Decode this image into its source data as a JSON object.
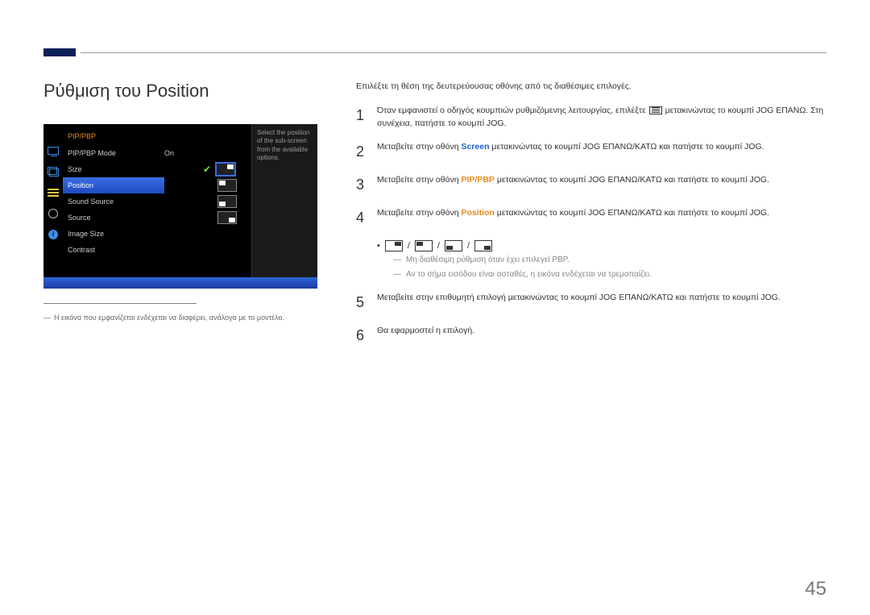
{
  "page_number": "45",
  "heading": "Ρύθμιση του Position",
  "osd": {
    "title": "PIP/PBP",
    "items": [
      {
        "label": "PIP/PBP Mode",
        "value": "On"
      },
      {
        "label": "Size",
        "value": ""
      },
      {
        "label": "Position",
        "value": ""
      },
      {
        "label": "Sound Source",
        "value": ""
      },
      {
        "label": "Source",
        "value": ""
      },
      {
        "label": "Image Size",
        "value": ""
      },
      {
        "label": "Contrast",
        "value": ""
      }
    ],
    "help": "Select the position of the sub-screen from the available options."
  },
  "left_footnote": "Η εικόνα που εμφανίζεται ενδέχεται να διαφέρει, ανάλογα με το μοντέλο.",
  "intro": "Επιλέξτε τη θέση της δευτερεύουσας οθόνης από τις διαθέσιμες επιλογές.",
  "steps": {
    "s1a": "Όταν εμφανιστεί ο οδηγός κουμπιών ρυθμιζόμενης λειτουργίας, επιλέξτε ",
    "s1b": " μετακινώντας το κουμπί JOG ΕΠΑΝΩ. Στη συνέχεια, πατήστε το κουμπί JOG.",
    "s2a": "Μεταβείτε στην οθόνη ",
    "s2_screen": "Screen",
    "s2b": " μετακινώντας το κουμπί JOG ΕΠΑΝΩ/ΚΑΤΩ και πατήστε το κουμπί JOG.",
    "s3a": "Μεταβείτε στην οθόνη ",
    "s3_pip": "PIP/PBP",
    "s3b": " μετακινώντας το κουμπί JOG ΕΠΑΝΩ/ΚΑΤΩ και πατήστε το κουμπί JOG.",
    "s4a": "Μεταβείτε στην οθόνη ",
    "s4_pos": "Position",
    "s4b": " μετακινώντας το κουμπί JOG ΕΠΑΝΩ/ΚΑΤΩ και πατήστε το κουμπί JOG.",
    "s5": "Μεταβείτε στην επιθυμητή επιλογή μετακινώντας το κουμπί JOG ΕΠΑΝΩ/ΚΑΤΩ και πατήστε το κουμπί JOG.",
    "s6": "Θα εφαρμοστεί η επιλογή."
  },
  "subnotes": {
    "n1": "Μη διαθέσιμη ρύθμιση όταν έχει επιλεγεί PBP.",
    "n2": "Αν το σήμα εισόδου είναι ασταθές, η εικόνα ενδέχεται να τρεμοπαίζει."
  },
  "sep": "/"
}
